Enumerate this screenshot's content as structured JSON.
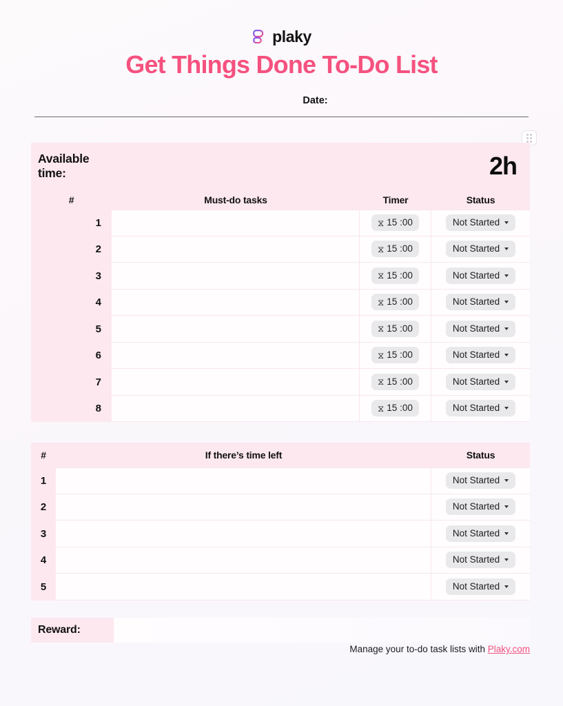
{
  "brand": {
    "name": "plaky",
    "logo_icon": "plaky-logo-icon",
    "gradient_from": "#7b5cf0",
    "gradient_to": "#f5527f"
  },
  "title": "Get Things Done To-Do List",
  "accent_color": "#f5527f",
  "pink_fill": "#fde8ef",
  "date": {
    "label": "Date:",
    "value": ""
  },
  "drag_handle": {
    "icon": "drag-handle-icon"
  },
  "available_time": {
    "label": "Available\ntime:",
    "label_line1": "Available",
    "label_line2": "time:",
    "value": "2h"
  },
  "main_table": {
    "headers": {
      "num": "#",
      "task": "Must-do tasks",
      "timer": "Timer",
      "status": "Status"
    },
    "rows": [
      {
        "num": "1",
        "task": "",
        "timer": "15 :00",
        "timer_icon": "hourglass-icon",
        "status": "Not Started"
      },
      {
        "num": "2",
        "task": "",
        "timer": "15 :00",
        "timer_icon": "hourglass-icon",
        "status": "Not Started"
      },
      {
        "num": "3",
        "task": "",
        "timer": "15 :00",
        "timer_icon": "hourglass-icon",
        "status": "Not Started"
      },
      {
        "num": "4",
        "task": "",
        "timer": "15 :00",
        "timer_icon": "hourglass-icon",
        "status": "Not Started"
      },
      {
        "num": "5",
        "task": "",
        "timer": "15 :00",
        "timer_icon": "hourglass-icon",
        "status": "Not Started"
      },
      {
        "num": "6",
        "task": "",
        "timer": "15 :00",
        "timer_icon": "hourglass-icon",
        "status": "Not Started"
      },
      {
        "num": "7",
        "task": "",
        "timer": "15 :00",
        "timer_icon": "hourglass-icon",
        "status": "Not Started"
      },
      {
        "num": "8",
        "task": "",
        "timer": "15 :00",
        "timer_icon": "hourglass-icon",
        "status": "Not Started"
      }
    ]
  },
  "extra_table": {
    "headers": {
      "num": "#",
      "task": "If there’s time left",
      "status": "Status"
    },
    "rows": [
      {
        "num": "1",
        "task": "",
        "status": "Not Started"
      },
      {
        "num": "2",
        "task": "",
        "status": "Not Started"
      },
      {
        "num": "3",
        "task": "",
        "status": "Not Started"
      },
      {
        "num": "4",
        "task": "",
        "status": "Not Started"
      },
      {
        "num": "5",
        "task": "",
        "status": "Not Started"
      }
    ]
  },
  "reward": {
    "label": "Reward:",
    "value": ""
  },
  "footer": {
    "text": "Manage your to-do task lists with ",
    "link_label": "Plaky.com"
  }
}
